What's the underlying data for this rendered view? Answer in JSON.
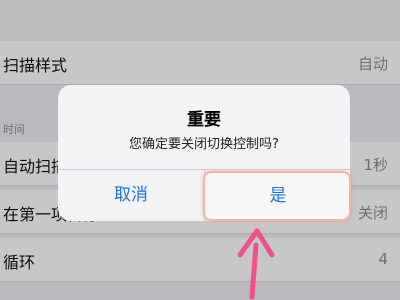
{
  "settings": {
    "scan_style": {
      "label": "扫描样式",
      "value": "自动"
    },
    "section_header": "时间",
    "auto_scan": {
      "label": "自动扫描",
      "value": "1秒"
    },
    "first_item": {
      "label": "在第一项暂停",
      "value": "关闭"
    },
    "loop": {
      "label": "循环",
      "value": "4"
    }
  },
  "alert": {
    "title": "重要",
    "message": "您确定要关闭切换控制吗?",
    "cancel_label": "取消",
    "confirm_label": "是"
  },
  "colors": {
    "accent": "#1a73e8",
    "annotation": "#f0508c"
  }
}
